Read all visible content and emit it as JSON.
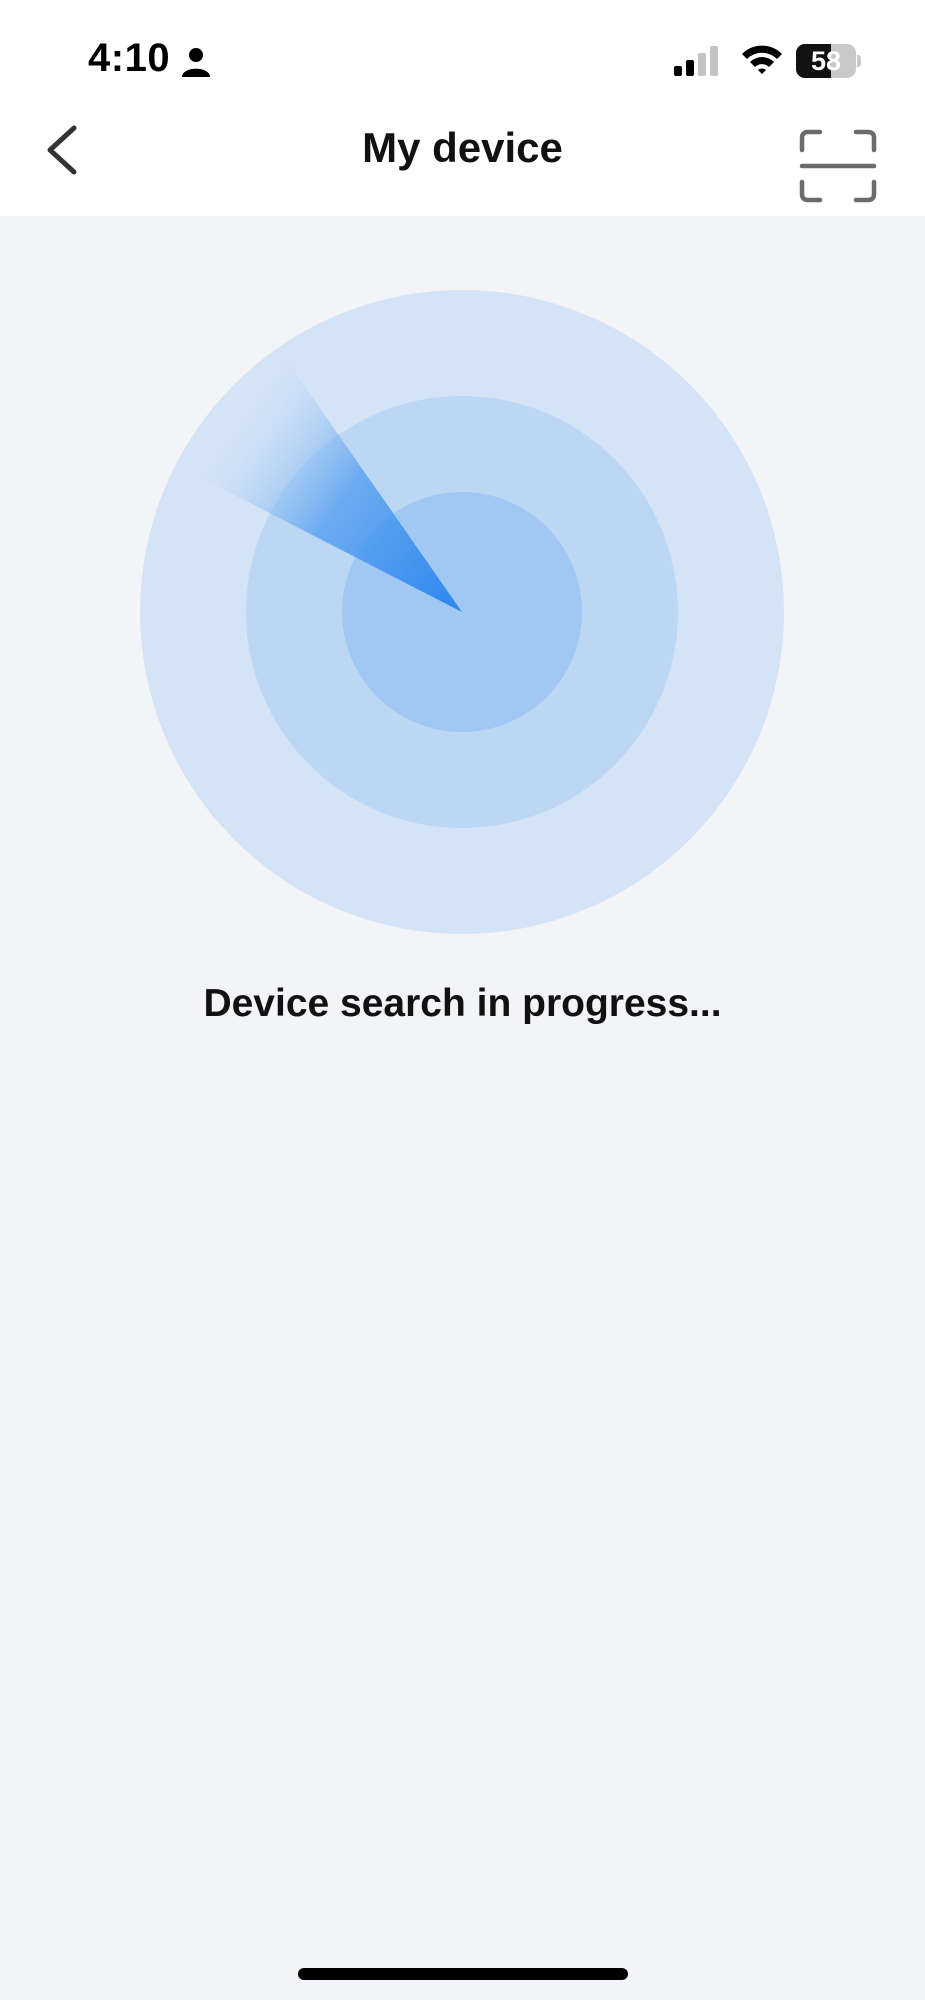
{
  "status_bar": {
    "time": "4:10",
    "battery_level": "58",
    "battery_percent": 58,
    "signal_bars_active": 2,
    "signal_bars_total": 4
  },
  "header": {
    "title": "My device",
    "back_icon": "chevron-left-icon",
    "scan_icon": "scan-frame-icon"
  },
  "main": {
    "status_text": "Device search in progress..."
  },
  "colors": {
    "background": "#f2f4f8",
    "header_background": "#ffffff",
    "radar_outer": "#d4e3f5",
    "radar_middle": "#bcd7f3",
    "radar_inner": "#a0c8f2",
    "radar_sweep": "#2b86ee",
    "text_primary": "#111111"
  }
}
